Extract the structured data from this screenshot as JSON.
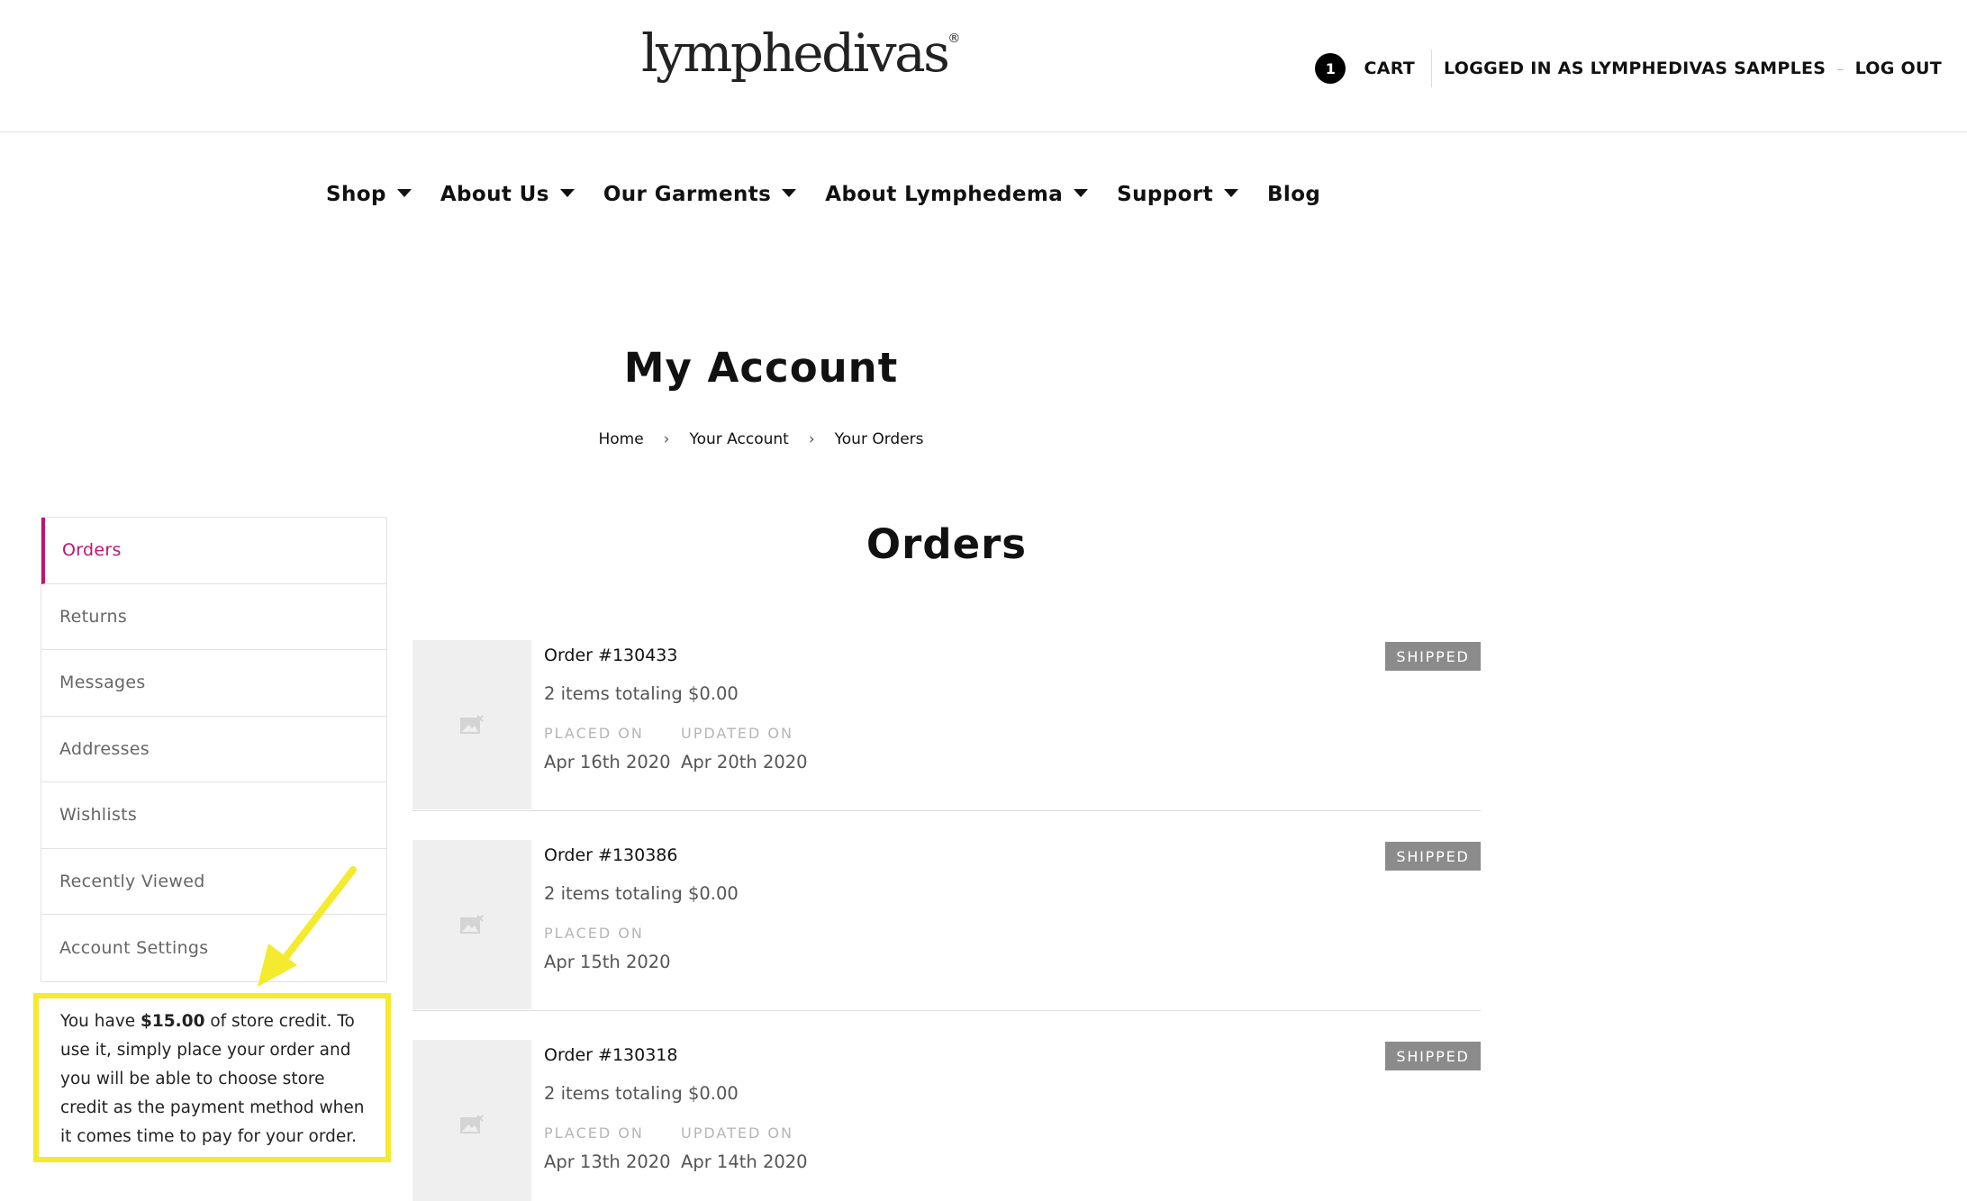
{
  "header": {
    "logo_main": "lymphedivas",
    "logo_mark": "®",
    "cart_count": "1",
    "cart_label": "CART",
    "logged_in": "LOGGED IN AS LYMPHEDIVAS SAMPLES",
    "separator": "–",
    "logout": "LOG OUT"
  },
  "nav": [
    {
      "label": "Shop",
      "dropdown": true
    },
    {
      "label": "About Us",
      "dropdown": true
    },
    {
      "label": "Our Garments",
      "dropdown": true
    },
    {
      "label": "About Lymphedema",
      "dropdown": true
    },
    {
      "label": "Support",
      "dropdown": true
    },
    {
      "label": "Blog",
      "dropdown": false
    }
  ],
  "page": {
    "title": "My Account",
    "breadcrumb": [
      "Home",
      "Your Account",
      "Your Orders"
    ]
  },
  "sidebar": {
    "items": [
      "Orders",
      "Returns",
      "Messages",
      "Addresses",
      "Wishlists",
      "Recently Viewed",
      "Account Settings"
    ],
    "active": "Orders"
  },
  "credit": {
    "before": "You have ",
    "amount": "$15.00",
    "after": " of store credit. To use it, simply place your order and you will be able to choose store credit as the payment method when it comes time to pay for your order."
  },
  "orders": {
    "title": "Orders",
    "placed_label": "PLACED ON",
    "updated_label": "UPDATED ON",
    "list": [
      {
        "number": "Order #130433",
        "summary": "2 items totaling $0.00",
        "status": "SHIPPED",
        "placed": "Apr 16th 2020",
        "updated": "Apr 20th 2020"
      },
      {
        "number": "Order #130386",
        "summary": "2 items totaling $0.00",
        "status": "SHIPPED",
        "placed": "Apr 15th 2020",
        "updated": ""
      },
      {
        "number": "Order #130318",
        "summary": "2 items totaling $0.00",
        "status": "SHIPPED",
        "placed": "Apr 13th 2020",
        "updated": "Apr 14th 2020"
      }
    ]
  },
  "colors": {
    "accent": "#c1136f",
    "highlight": "#f4ea2e",
    "badge": "#8b8b8b"
  },
  "icons": {
    "thumb": "image-placeholder-icon",
    "caret": "caret-down-icon",
    "chevron": "chevron-right-icon",
    "annotation": "yellow-arrow-icon"
  }
}
